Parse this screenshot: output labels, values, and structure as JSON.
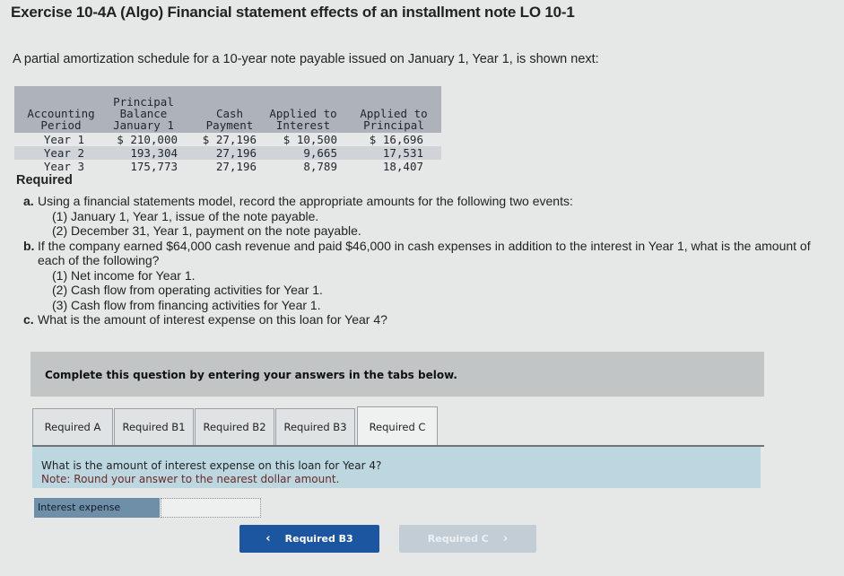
{
  "title": "Exercise 10-4A (Algo) Financial statement effects of an installment note LO 10-1",
  "intro": "A partial amortization schedule for a 10-year note payable issued on January 1, Year 1, is shown next:",
  "schedule": {
    "headers": [
      [
        "Accounting",
        "Period"
      ],
      [
        "Principal",
        "Balance",
        "January 1"
      ],
      [
        "Cash",
        "Payment"
      ],
      [
        "Applied to",
        "Interest"
      ],
      [
        "Applied to",
        "Principal"
      ]
    ],
    "rows": [
      [
        "Year 1",
        "$ 210,000",
        "$ 27,196",
        "$ 10,500",
        "$ 16,696"
      ],
      [
        "Year 2",
        "193,304",
        "27,196",
        "9,665",
        "17,531"
      ],
      [
        "Year 3",
        "175,773",
        "27,196",
        "8,789",
        "18,407"
      ]
    ]
  },
  "required_heading": "Required",
  "requirements": {
    "a": {
      "letter": "a.",
      "text": "Using a financial statements model, record the appropriate amounts for the following two events:",
      "subs": [
        "(1) January 1, Year 1, issue of the note payable.",
        "(2) December 31, Year 1, payment on the note payable."
      ]
    },
    "b": {
      "letter": "b.",
      "text": "If the company earned $64,000 cash revenue and paid $46,000 in cash expenses in addition to the interest in Year 1, what is the amount of each of the following?",
      "subs": [
        "(1) Net income for Year 1.",
        "(2) Cash flow from operating activities for Year 1.",
        "(3) Cash flow from financing activities for Year 1."
      ]
    },
    "c": {
      "letter": "c.",
      "text": "What is the amount of interest expense on this loan for Year 4?"
    }
  },
  "instructions": "Complete this question by entering your answers in the tabs below.",
  "tabs": [
    {
      "label": "Required A",
      "active": false
    },
    {
      "label": "Required B1",
      "active": false
    },
    {
      "label": "Required B2",
      "active": false
    },
    {
      "label": "Required B3",
      "active": false
    },
    {
      "label": "Required C",
      "active": true
    }
  ],
  "panel": {
    "question": "What is the amount of interest expense on this loan for Year 4?",
    "note": "Note: Round your answer to the nearest dollar amount."
  },
  "answer": {
    "label": "Interest expense",
    "value": ""
  },
  "nav": {
    "prev_label": "Required B3",
    "next_label": "Required C",
    "prev_icon": "‹",
    "next_icon": "›"
  }
}
